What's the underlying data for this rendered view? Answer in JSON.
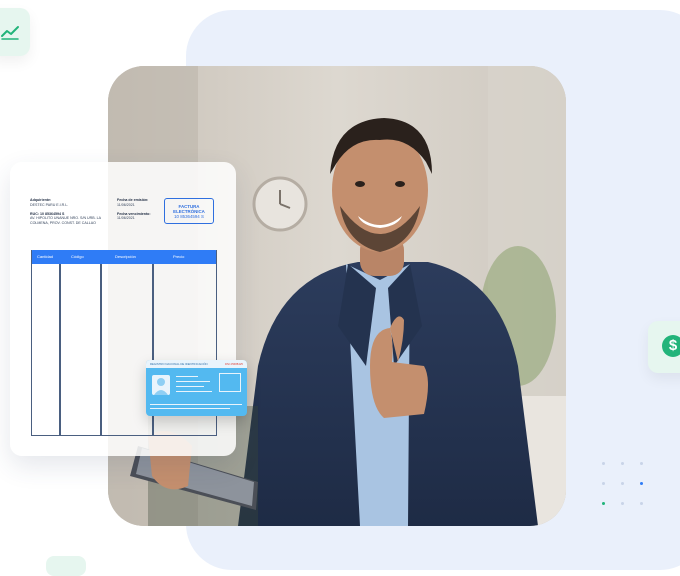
{
  "invoice": {
    "issuer_label": "Adquiriente:",
    "issuer_name": "DESTEC PARU E.I.R.L.",
    "ruc_label": "RUC: 10 85364594 S",
    "address_line1": "AV. HIPOLITO UNANUE NRO. S/N URB. LA",
    "address_line2": "COLMENA, PROV. CONST. DE CALLAO",
    "issue_date_label": "Fecha de emisión:",
    "issue_date": "11/06/2021",
    "due_date_label": "Fecha vencimiento:",
    "due_date": "11/06/2021",
    "doc_type_line1": "FACTURA",
    "doc_type_line2": "ELECTRÓNICA",
    "doc_number": "10 85364594 S",
    "columns": [
      "Cantidad",
      "Código",
      "Descripción",
      "Precio"
    ]
  },
  "id_card": {
    "header": "REGISTRO NACIONAL DE IDENTIFICACIÓN",
    "header_right": "DNI 25688425"
  },
  "icons": {
    "chart": "trend-up-icon",
    "dollar": "dollar-circle-icon",
    "dollar_glyph": "$"
  },
  "colors": {
    "accent_blue": "#2f7cf6",
    "accent_green": "#22b47a",
    "panel_bg": "#eaf0fb"
  }
}
